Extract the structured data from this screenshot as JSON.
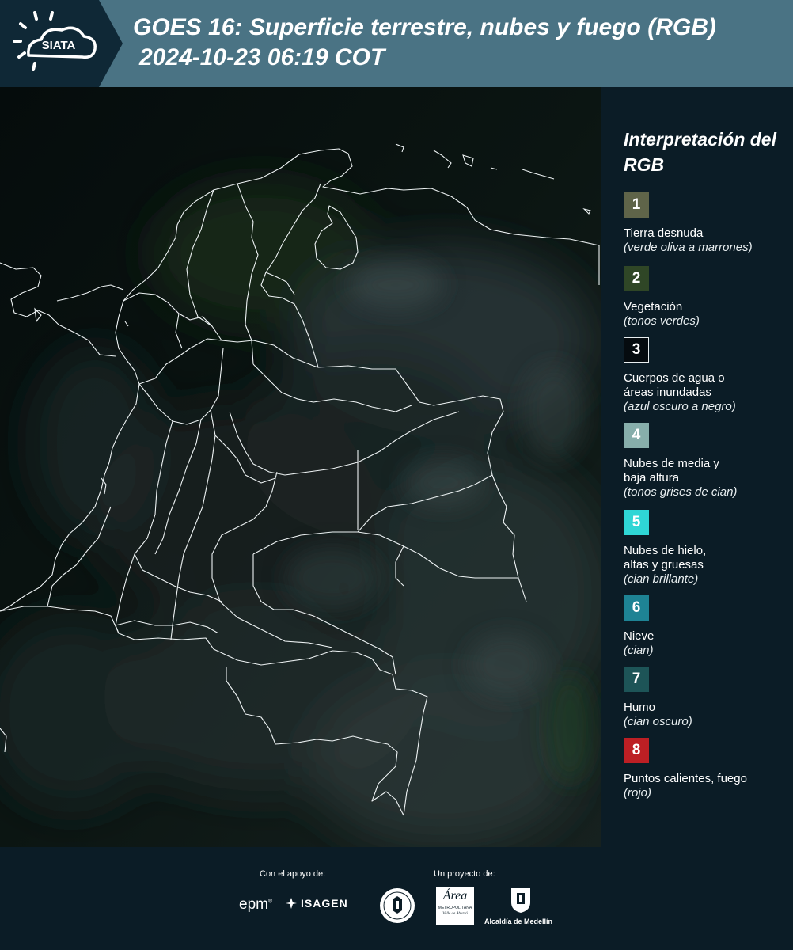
{
  "brand": {
    "name": "SIATA"
  },
  "header": {
    "title_line1": "GOES 16: Superficie terrestre, nubes y fuego (RGB)",
    "title_line2": "2024-10-23 06:19 COT"
  },
  "legend": {
    "title": "Interpretación del RGB",
    "items": [
      {
        "num": "1",
        "label": "Tierra desnuda",
        "note": "(verde oliva a marrones)",
        "color": "#5f6449"
      },
      {
        "num": "2",
        "label": "Vegetación",
        "note": "(tonos verdes)",
        "color": "#2f4626"
      },
      {
        "num": "3",
        "label": "Cuerpos de agua o áreas inundadas",
        "note": "(azul oscuro a negro)",
        "color": "#050b0f"
      },
      {
        "num": "4",
        "label": "Nubes de media y baja altura",
        "note": "(tonos grises de cian)",
        "color": "#87aeab"
      },
      {
        "num": "5",
        "label": "Nubes de hielo, altas y gruesas",
        "note": "(cian brillante)",
        "color": "#2fd6d5"
      },
      {
        "num": "6",
        "label": "Nieve",
        "note": "(cian)",
        "color": "#1e8394"
      },
      {
        "num": "7",
        "label": "Humo",
        "note": "(cian oscuro)",
        "color": "#1d5457"
      },
      {
        "num": "8",
        "label": "Puntos calientes, fuego",
        "note": "(rojo)",
        "color": "#bd1f24"
      }
    ]
  },
  "footer": {
    "support_label": "Con el apoyo de:",
    "project_label": "Un proyecto de:",
    "sponsor_epm": "epm",
    "sponsor_isagen": "ISAGEN",
    "partner_area_line1": "Área",
    "partner_area_line2": "METROPOLITANA",
    "partner_area_line3": "Valle de Aburrá",
    "partner_medellin": "Alcaldía de Medellín"
  }
}
